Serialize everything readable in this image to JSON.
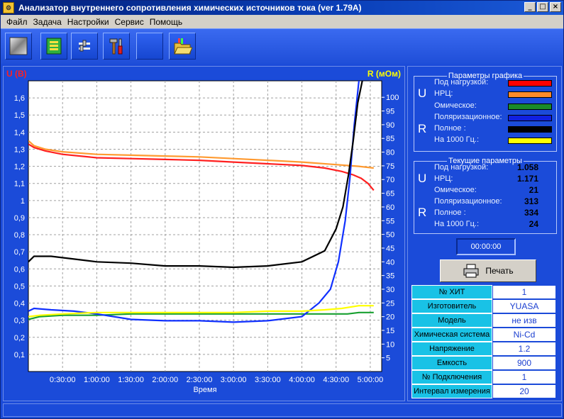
{
  "window": {
    "title": "Анализатор внутреннего сопротивления химических источников тока (ver 1.79A)"
  },
  "menu": [
    "Файл",
    "Задача",
    "Настройки",
    "Сервис",
    "Помощь"
  ],
  "toolbar": {
    "buttons": [
      {
        "name": "new-measurement-button",
        "icon": "metal-plate-icon"
      },
      {
        "name": "battery-module-button",
        "icon": "circuit-board-icon"
      },
      {
        "name": "settings-button",
        "icon": "settings-sliders-icon"
      },
      {
        "name": "tools-button",
        "icon": "hammer-screwdriver-icon"
      },
      {
        "name": "blank-button",
        "icon": "blank-icon"
      },
      {
        "name": "open-folder-button",
        "icon": "folder-icon"
      }
    ]
  },
  "chart_data": {
    "type": "line",
    "y_left_label": "U (В)",
    "y_right_label": "R (мОм)",
    "xlabel": "Время",
    "x_ticks": [
      "0:30:00",
      "1:00:00",
      "1:30:00",
      "2:00:00",
      "2:30:00",
      "3:00:00",
      "3:30:00",
      "4:00:00",
      "4:30:00",
      "5:00:00"
    ],
    "y_left_ticks": [
      "0,1",
      "0,2",
      "0,3",
      "0,4",
      "0,5",
      "0,6",
      "0,7",
      "0,8",
      "0,9",
      "1",
      "1,1",
      "1,2",
      "1,3",
      "1,4",
      "1,5",
      "1,6"
    ],
    "y_right_ticks": [
      "5",
      "10",
      "15",
      "20",
      "25",
      "30",
      "35",
      "40",
      "45",
      "50",
      "55",
      "60",
      "65",
      "70",
      "75",
      "80",
      "85",
      "90",
      "95",
      "100"
    ],
    "xlim_minutes": [
      0,
      310
    ],
    "ylim_left": [
      0,
      1.7
    ],
    "ylim_right": [
      0,
      106
    ],
    "grid": true,
    "series": [
      {
        "name": "Под нагрузкой",
        "axis": "left",
        "color": "#ff2020",
        "x": [
          0,
          5,
          15,
          30,
          60,
          90,
          120,
          150,
          180,
          210,
          240,
          260,
          275,
          285,
          292,
          298,
          303
        ],
        "y": [
          1.33,
          1.31,
          1.29,
          1.27,
          1.25,
          1.245,
          1.24,
          1.235,
          1.225,
          1.215,
          1.205,
          1.19,
          1.17,
          1.15,
          1.13,
          1.1,
          1.06
        ]
      },
      {
        "name": "НРЦ",
        "axis": "left",
        "color": "#ff9a30",
        "x": [
          0,
          5,
          15,
          30,
          60,
          90,
          120,
          150,
          180,
          210,
          240,
          270,
          290,
          303
        ],
        "y": [
          1.35,
          1.32,
          1.3,
          1.285,
          1.27,
          1.265,
          1.26,
          1.255,
          1.245,
          1.235,
          1.225,
          1.21,
          1.2,
          1.19
        ]
      },
      {
        "name": "Омическое",
        "axis": "right",
        "color": "#18a030",
        "x": [
          0,
          10,
          30,
          60,
          90,
          120,
          150,
          180,
          210,
          240,
          260,
          270,
          280,
          290,
          303
        ],
        "y": [
          19,
          20,
          20.5,
          20.5,
          21,
          21,
          21,
          21,
          21,
          21,
          21,
          21,
          21,
          21.5,
          21.5
        ]
      },
      {
        "name": "Поляризационное",
        "axis": "right",
        "color": "#1030ff",
        "x": [
          0,
          5,
          20,
          40,
          60,
          90,
          120,
          150,
          180,
          210,
          240,
          255,
          265,
          272,
          278,
          282,
          286,
          290
        ],
        "y": [
          22,
          23,
          22.5,
          22,
          21,
          19,
          18.5,
          18.5,
          18,
          18.5,
          20,
          25,
          30,
          40,
          55,
          70,
          90,
          106
        ]
      },
      {
        "name": "Полное",
        "axis": "right",
        "color": "#000000",
        "x": [
          0,
          5,
          20,
          40,
          60,
          90,
          120,
          150,
          180,
          210,
          240,
          260,
          270,
          276,
          281,
          285,
          289,
          293
        ],
        "y": [
          40,
          42,
          42,
          41,
          40,
          39.5,
          38.5,
          38.5,
          38,
          38.5,
          40,
          44,
          52,
          60,
          72,
          84,
          98,
          106
        ]
      },
      {
        "name": "На 1000 Гц.",
        "axis": "right",
        "color": "#ffff00",
        "x": [
          0,
          10,
          30,
          60,
          90,
          120,
          150,
          180,
          210,
          240,
          260,
          275,
          290,
          303
        ],
        "y": [
          20,
          20.5,
          21,
          21.5,
          21.5,
          21.5,
          21.5,
          21.5,
          22,
          22,
          22.5,
          23,
          24,
          24
        ]
      }
    ]
  },
  "graph_params": {
    "title": "Параметры графика",
    "u_letter": "U",
    "r_letter": "R",
    "items": [
      {
        "label": "Под нагрузкой:",
        "color": "#ff0000"
      },
      {
        "label": "НРЦ:",
        "color": "#ff8a2a"
      },
      {
        "label": "Омическое:",
        "color": "#1a8a2a"
      },
      {
        "label": "Поляризационное:",
        "color": "#1020e0"
      },
      {
        "label": "Полное :",
        "color": "#000000"
      },
      {
        "label": "На 1000 Гц.:",
        "color": "#ffff00"
      }
    ]
  },
  "current_params": {
    "title": "Текущие параметры",
    "u_letter": "U",
    "r_letter": "R",
    "items": [
      {
        "label": "Под нагрузкой:",
        "value": "1.058"
      },
      {
        "label": "НРЦ:",
        "value": "1.171"
      },
      {
        "label": "Омическое:",
        "value": "21"
      },
      {
        "label": "Поляризационное:",
        "value": "313"
      },
      {
        "label": "Полное :",
        "value": "334"
      },
      {
        "label": "На 1000 Гц.:",
        "value": "24"
      }
    ]
  },
  "timer": "00:00:00",
  "print_label": "Печать",
  "info": [
    {
      "key": "№ ХИТ",
      "value": "1"
    },
    {
      "key": "Изготовитель",
      "value": "YUASA"
    },
    {
      "key": "Модель",
      "value": "не изв"
    },
    {
      "key": "Химическая система",
      "value": "Ni-Cd"
    },
    {
      "key": "Напряжение",
      "value": "1.2"
    },
    {
      "key": "Емкость",
      "value": "900"
    },
    {
      "key": "№ Подключения",
      "value": "1"
    },
    {
      "key": "Интервал измерения",
      "value": "20"
    }
  ]
}
